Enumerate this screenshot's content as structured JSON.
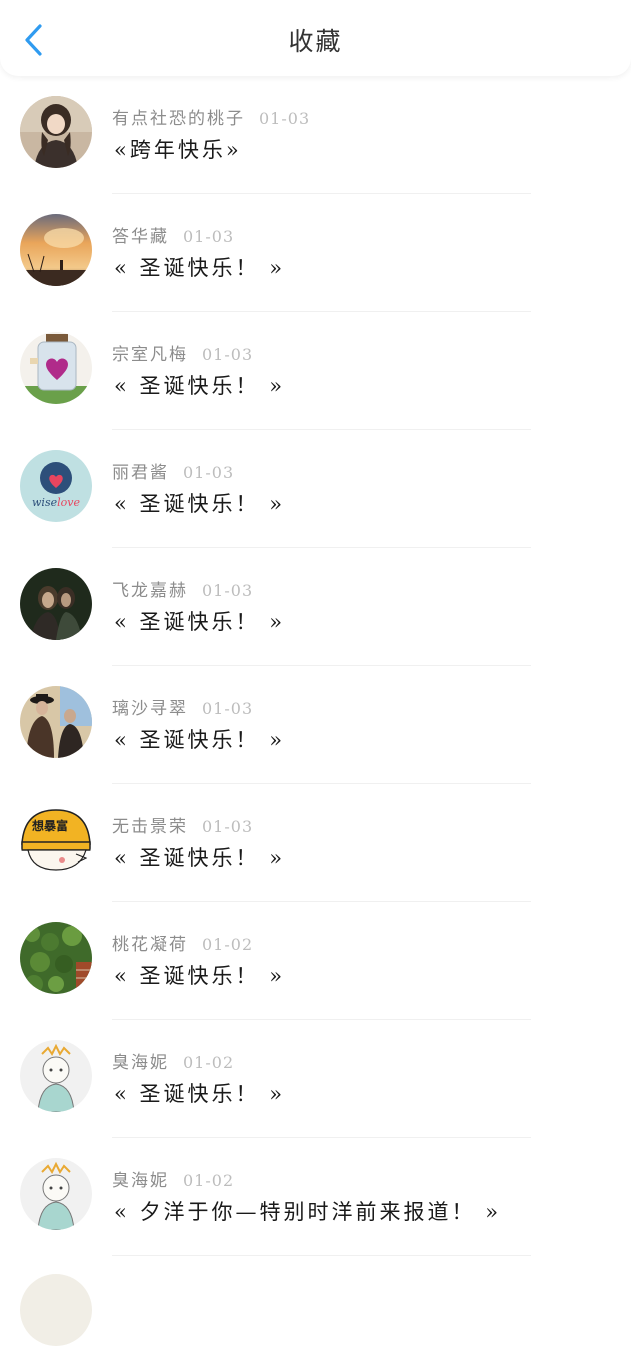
{
  "header": {
    "title": "收藏",
    "back_icon": "chevron-left-icon",
    "accent": "#2f9bf0"
  },
  "items": [
    {
      "name": "有点社恐的桃子",
      "date": "01-03",
      "message": "«跨年快乐»",
      "avatar": "girl-portrait"
    },
    {
      "name": "答华藏",
      "date": "01-03",
      "message": "« 圣诞快乐！ »",
      "avatar": "sunset-sky"
    },
    {
      "name": "宗室凡梅",
      "date": "01-03",
      "message": "« 圣诞快乐！ »",
      "avatar": "heart-jar"
    },
    {
      "name": "丽君酱",
      "date": "01-03",
      "message": "« 圣诞快乐！ »",
      "avatar": "wiselove-logo"
    },
    {
      "name": "飞龙嘉赫",
      "date": "01-03",
      "message": "« 圣诞快乐！ »",
      "avatar": "couple-dark"
    },
    {
      "name": "璃沙寻翠",
      "date": "01-03",
      "message": "« 圣诞快乐！ »",
      "avatar": "couple-hats"
    },
    {
      "name": "无击景荣",
      "date": "01-03",
      "message": "« 圣诞快乐！ »",
      "avatar": "cartoon-helmet"
    },
    {
      "name": "桃花凝荷",
      "date": "01-02",
      "message": "« 圣诞快乐！ »",
      "avatar": "ivy-wall"
    },
    {
      "name": "臭海妮",
      "date": "01-02",
      "message": "« 圣诞快乐！ »",
      "avatar": "sketch-character"
    },
    {
      "name": "臭海妮",
      "date": "01-02",
      "message": "« 夕洋于你—特别时洋前来报道！ »",
      "avatar": "sketch-character"
    }
  ]
}
